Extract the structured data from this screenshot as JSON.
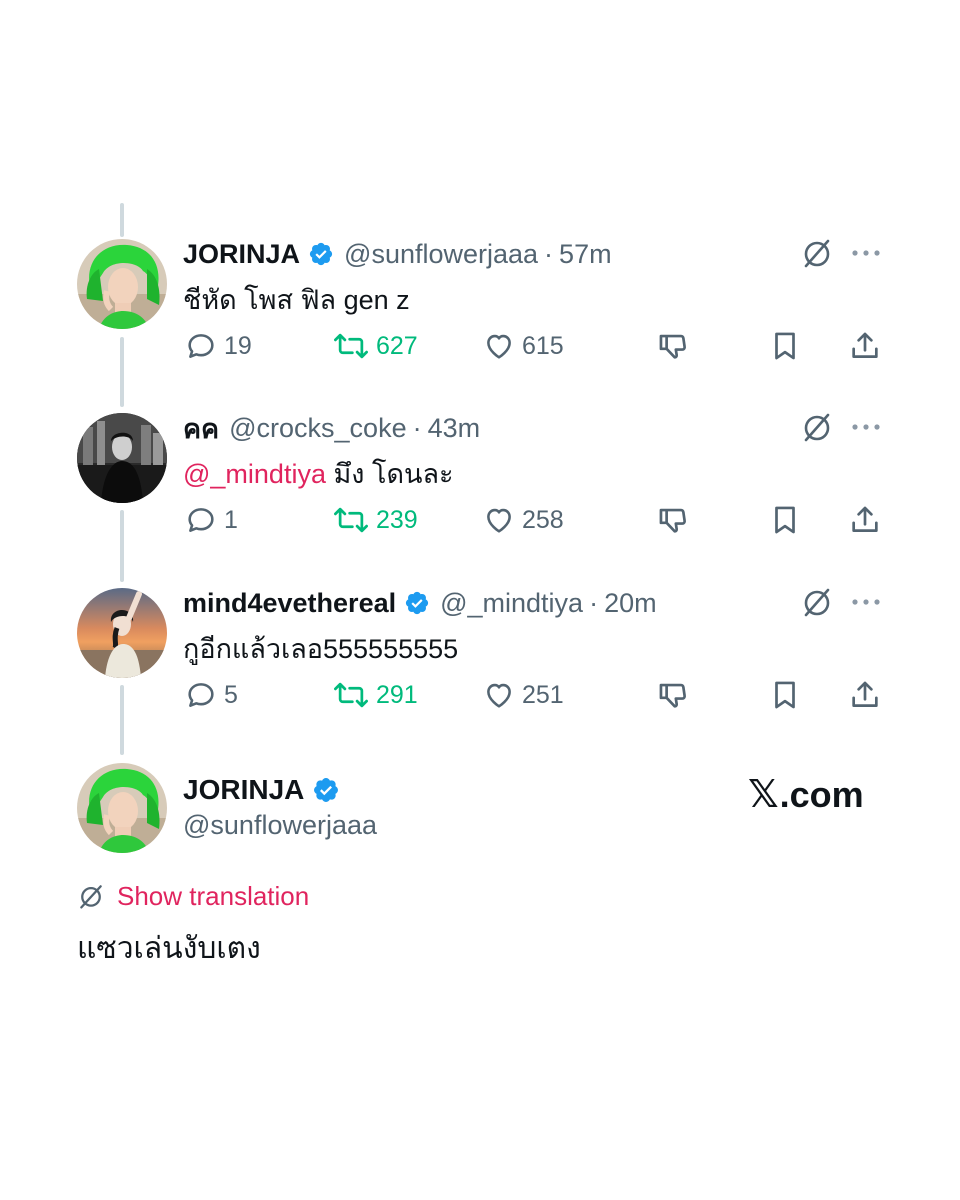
{
  "replies": [
    {
      "name": "JORINJA",
      "verified": true,
      "handle": "@sunflowerjaaa",
      "time": "57m",
      "text": "ชีหัด โพส ฟิล gen z",
      "mention": "",
      "reply_count": "19",
      "retweet_count": "627",
      "like_count": "615",
      "avatar": "green-hair-portrait"
    },
    {
      "name": "คค",
      "verified": false,
      "handle": "@crocks_coke",
      "time": "43m",
      "text": "มึง โดนละ",
      "mention": "@_mindtiya",
      "reply_count": "1",
      "retweet_count": "239",
      "like_count": "258",
      "avatar": "city-night-portrait"
    },
    {
      "name": "mind4evethereal",
      "verified": true,
      "handle": "@_mindtiya",
      "time": "20m",
      "text": "กูอีกแล้วเลอ555555555",
      "mention": "",
      "reply_count": "5",
      "retweet_count": "291",
      "like_count": "251",
      "avatar": "sunset-beach-portrait"
    }
  ],
  "main_tweet": {
    "name": "JORINJA",
    "verified": true,
    "handle": "@sunflowerjaaa",
    "show_translation": "Show translation",
    "text": "แซวเล่นงับเตง"
  },
  "brand": {
    "x_mark": "𝕏",
    "domain": ".com"
  },
  "icons": {
    "reply": "reply-icon",
    "retweet": "retweet-icon",
    "like": "like-icon",
    "dislike": "dislike-icon",
    "bookmark": "bookmark-icon",
    "share": "share-icon",
    "translate": "translate-icon",
    "more": "more-icon",
    "verified": "verified-badge-icon"
  },
  "colors": {
    "text": "#0f1419",
    "secondary": "#536471",
    "retweet": "#00ba7c",
    "verified": "#1d9bf0",
    "mention": "#e0245e",
    "thread_line": "#cfd9de"
  }
}
